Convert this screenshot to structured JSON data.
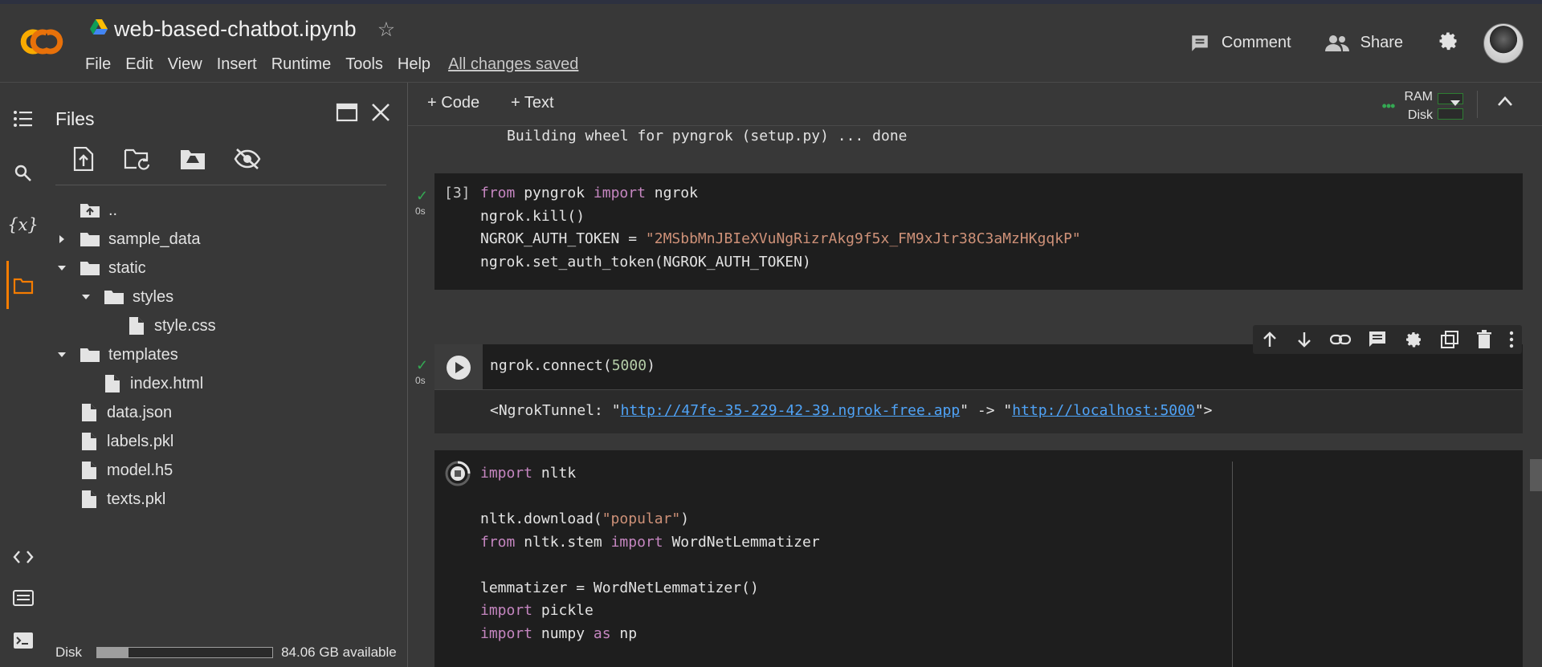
{
  "header": {
    "notebook_title": "web-based-chatbot.ipynb",
    "menu": [
      "File",
      "Edit",
      "View",
      "Insert",
      "Runtime",
      "Tools",
      "Help"
    ],
    "save_status": "All changes saved",
    "comment_label": "Comment",
    "share_label": "Share"
  },
  "files_panel": {
    "title": "Files",
    "tree": [
      {
        "label": "..",
        "type": "parent"
      },
      {
        "label": "sample_data",
        "type": "folder",
        "state": "collapsed"
      },
      {
        "label": "static",
        "type": "folder",
        "state": "expanded"
      },
      {
        "label": "styles",
        "type": "folder",
        "state": "expanded"
      },
      {
        "label": "style.css",
        "type": "file"
      },
      {
        "label": "templates",
        "type": "folder",
        "state": "expanded"
      },
      {
        "label": "index.html",
        "type": "file"
      },
      {
        "label": "data.json",
        "type": "file"
      },
      {
        "label": "labels.pkl",
        "type": "file"
      },
      {
        "label": "model.h5",
        "type": "file"
      },
      {
        "label": "texts.pkl",
        "type": "file"
      }
    ],
    "disk_label": "Disk",
    "disk_available": "84.06 GB available",
    "disk_used_fraction": 0.18
  },
  "toolbar": {
    "add_code": "Code",
    "add_text": "Text",
    "ram_label": "RAM",
    "disk_label": "Disk"
  },
  "output_top": "Building wheel for pyngrok (setup.py) ... done",
  "cell3": {
    "exec_count": "[3]",
    "time": "0s",
    "token_value": "\"2MSbbMnJBIeXVuNgRizrAkg9f5x_FM9xJtr38C3aMzHKgqkP\""
  },
  "cell4": {
    "time": "0s",
    "port": "5000",
    "out_prefix": "<NgrokTunnel: \"",
    "out_url1": "http://47fe-35-229-42-39.ngrok-free.app",
    "out_mid": "\" -> \"",
    "out_url2": "http://localhost:5000",
    "out_suffix": "\">"
  },
  "cell5": {
    "download_arg": "\"popular\""
  },
  "colors": {
    "accent": "#f57c00",
    "success": "#34a853",
    "keyword": "#c586c0",
    "string": "#ce9178",
    "link": "#4fa3f7"
  }
}
